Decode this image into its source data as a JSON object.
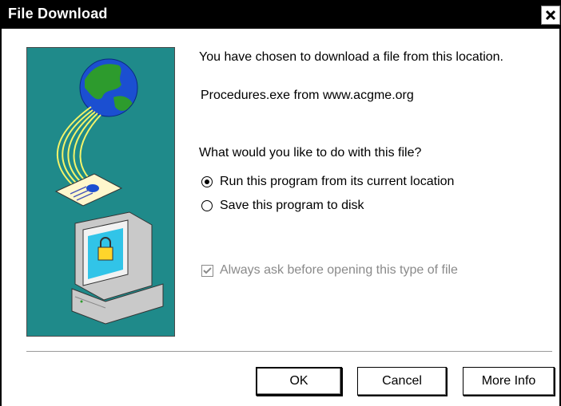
{
  "window": {
    "title": "File Download"
  },
  "content": {
    "intro_text": "You have chosen to download a file from this location.",
    "file_source": "Procedures.exe from www.acgme.org",
    "question": "What would you like to do with this file?",
    "options": [
      {
        "label": "Run this program from its current location",
        "selected": true
      },
      {
        "label": "Save this program to disk",
        "selected": false
      }
    ],
    "always_ask": {
      "label": "Always ask before opening this type of file",
      "checked": true,
      "enabled": false
    }
  },
  "buttons": {
    "ok": "OK",
    "cancel": "Cancel",
    "more_info": "More Info"
  },
  "colors": {
    "titlebar": "#000000",
    "art_background": "#1f8a8a",
    "disabled_text": "#8a8a8a"
  },
  "icons": [
    "close-icon",
    "globe-icon",
    "document-icon",
    "computer-lock-icon",
    "radio-icon",
    "checkbox-icon"
  ]
}
